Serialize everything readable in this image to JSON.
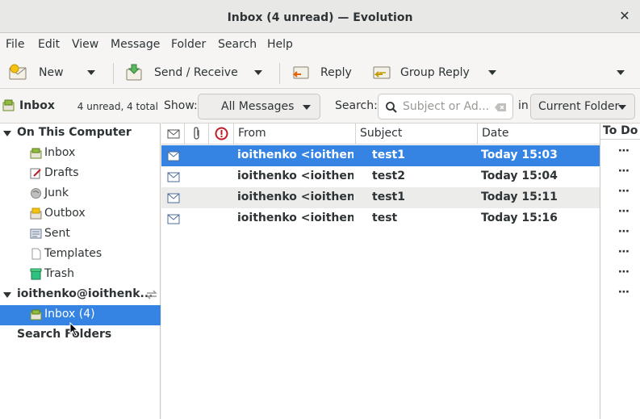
{
  "window": {
    "title": "Inbox (4 unread) — Evolution",
    "close_glyph": "✕"
  },
  "menu": [
    "File",
    "Edit",
    "View",
    "Message",
    "Folder",
    "Search",
    "Help"
  ],
  "toolbar": {
    "new_label": "New",
    "send_receive_label": "Send / Receive",
    "reply_label": "Reply",
    "group_reply_label": "Group Reply"
  },
  "sidebar": {
    "header_label": "Inbox",
    "header_count": "4 unread, 4 total",
    "local_group": "On This Computer",
    "local_folders": [
      "Inbox",
      "Drafts",
      "Junk",
      "Outbox",
      "Sent",
      "Templates",
      "Trash"
    ],
    "account_label": "ioithenko@ioithenk...",
    "account_inbox": "Inbox (4)",
    "search_folders": "Search Folders"
  },
  "searchbar": {
    "show_label": "Show:",
    "show_value": "All Messages",
    "search_label": "Search:",
    "search_placeholder": "Subject or Ad...",
    "in_label": "in",
    "scope_value": "Current Folder"
  },
  "columns": {
    "from": "From",
    "subject": "Subject",
    "date": "Date"
  },
  "messages": [
    {
      "from": "ioithenko <ioithen...",
      "subject": "test1",
      "date": "Today 15:03"
    },
    {
      "from": "ioithenko <ioithen...",
      "subject": "test2",
      "date": "Today 15:04"
    },
    {
      "from": "ioithenko <ioithen...",
      "subject": "test1",
      "date": "Today 15:11"
    },
    {
      "from": "ioithenko <ioithen...",
      "subject": "test",
      "date": "Today 15:16"
    }
  ],
  "todo": {
    "title": "To Do",
    "dots": "⋯"
  },
  "colors": {
    "accent": "#3584e4"
  }
}
